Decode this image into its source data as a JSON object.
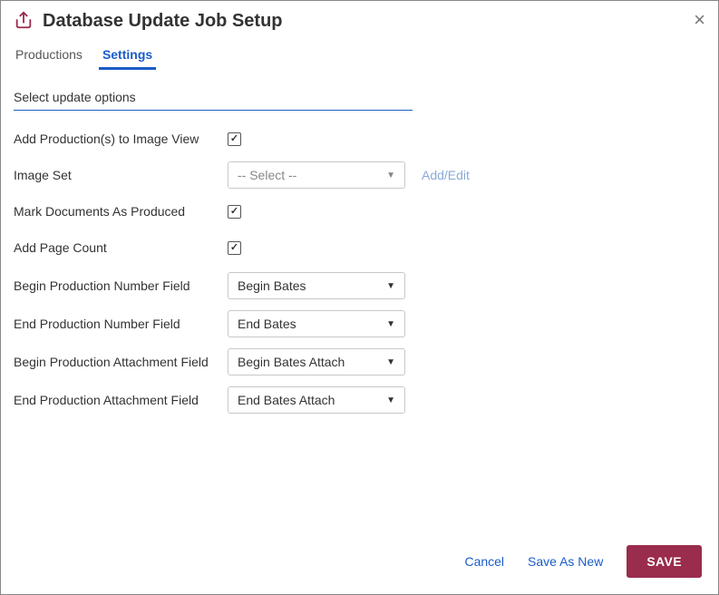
{
  "header": {
    "title": "Database Update Job Setup"
  },
  "tabs": {
    "productions": "Productions",
    "settings": "Settings"
  },
  "section": {
    "title": "Select update options"
  },
  "rows": {
    "addProdToImageView": "Add Production(s) to Image View",
    "imageSet": "Image Set",
    "imageSetPlaceholder": "-- Select --",
    "addEdit": "Add/Edit",
    "markDocsProduced": "Mark Documents As Produced",
    "addPageCount": "Add Page Count",
    "beginProdNumField": "Begin Production Number Field",
    "beginProdNumValue": "Begin Bates",
    "endProdNumField": "End Production Number Field",
    "endProdNumValue": "End Bates",
    "beginProdAttachField": "Begin Production Attachment Field",
    "beginProdAttachValue": "Begin Bates Attach",
    "endProdAttachField": "End Production Attachment Field",
    "endProdAttachValue": "End Bates Attach"
  },
  "footer": {
    "cancel": "Cancel",
    "saveAsNew": "Save As New",
    "save": "SAVE"
  }
}
